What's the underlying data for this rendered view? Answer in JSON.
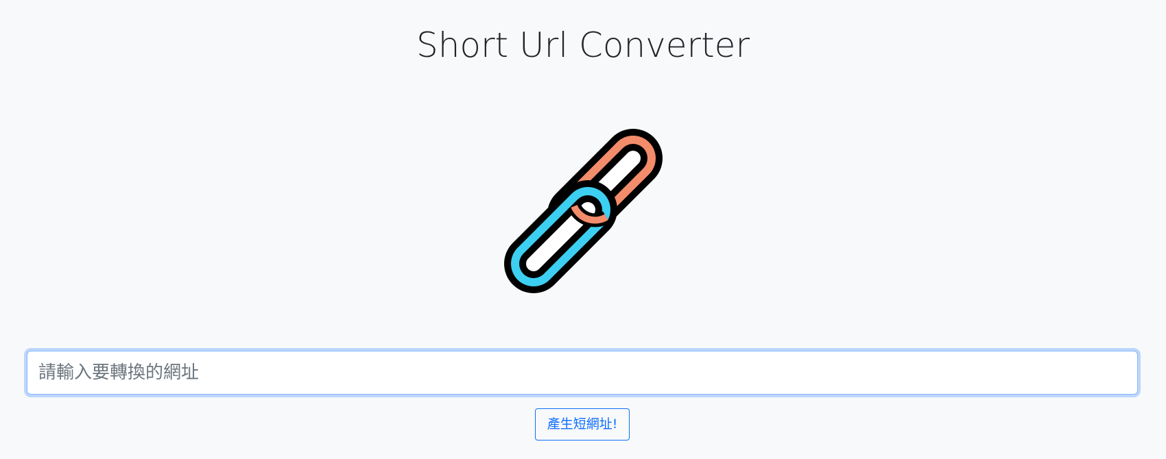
{
  "header": {
    "title": "Short Url Converter"
  },
  "logo": {
    "icon": "chain-link-icon",
    "colors": {
      "left_link": "#3dcff1",
      "right_link": "#f28c6b",
      "outline": "#000000"
    }
  },
  "form": {
    "url_input": {
      "value": "",
      "placeholder": "請輸入要轉換的網址"
    },
    "submit_label": "產生短網址!"
  },
  "colors": {
    "background": "#f8f9fa",
    "accent": "#0d6efd",
    "focus_ring": "#86b7fe"
  }
}
